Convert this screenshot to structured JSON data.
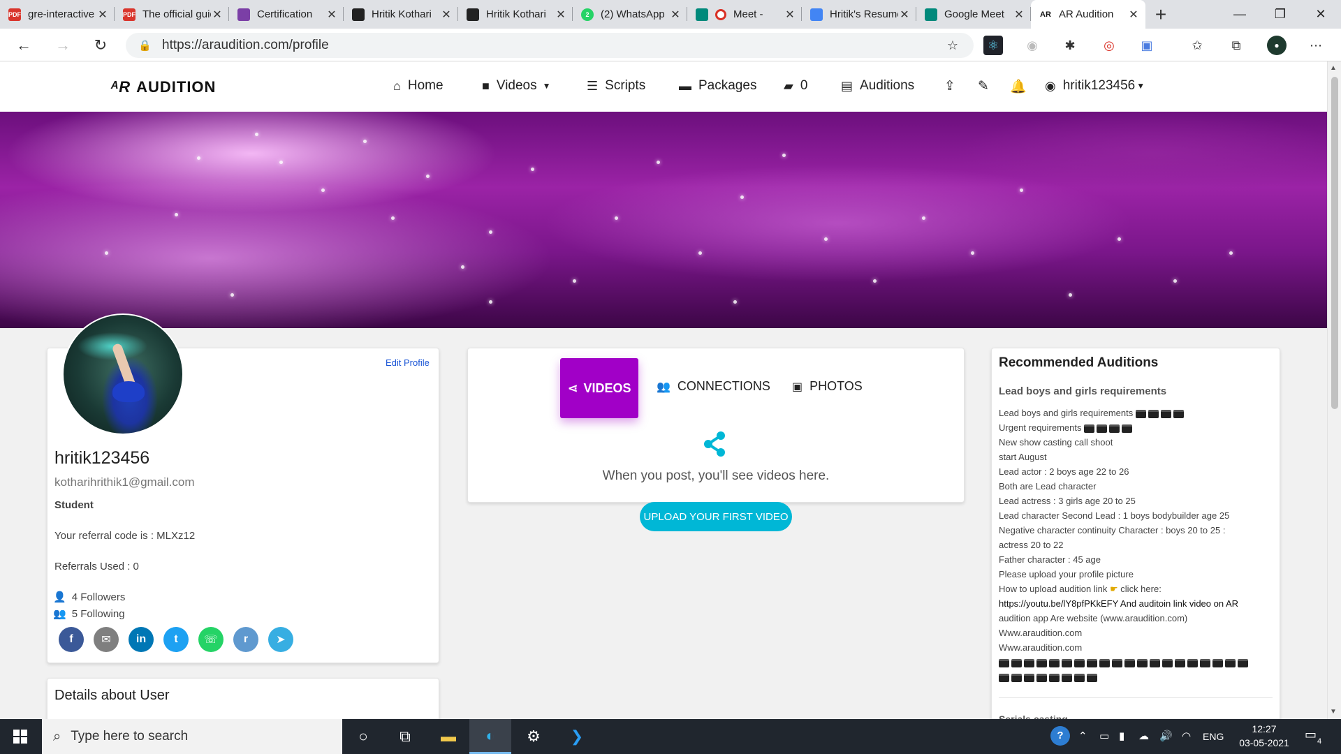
{
  "browser": {
    "tabs": [
      {
        "label": "gre-interactive",
        "fav_color": "#d9352c",
        "fav_text": "PDF"
      },
      {
        "label": "The official guide",
        "fav_color": "#d9352c",
        "fav_text": "PDF"
      },
      {
        "label": "Certification",
        "fav_color": "#7b3fa6",
        "fav_text": ""
      },
      {
        "label": "Hritik Kothari",
        "fav_color": "#222222",
        "fav_text": ""
      },
      {
        "label": "Hritik Kothari",
        "fav_color": "#222222",
        "fav_text": ""
      },
      {
        "label": "(2) WhatsApp",
        "fav_color": "#25d366",
        "fav_text": "2"
      },
      {
        "label": "Meet -",
        "fav_color": "#00897b",
        "fav_text": ""
      },
      {
        "label": "Hritik's Resume",
        "fav_color": "#4285f4",
        "fav_text": ""
      },
      {
        "label": "Google Meet",
        "fav_color": "#00897b",
        "fav_text": ""
      },
      {
        "label": "AR Audition",
        "fav_color": "#111111",
        "fav_text": "AR",
        "active": true
      }
    ],
    "url": "https://araudition.com/profile"
  },
  "site": {
    "logo": "AUDITION",
    "nav": {
      "home": "Home",
      "videos": "Videos",
      "scripts": "Scripts",
      "packages": "Packages",
      "wallet_count": "0",
      "auditions": "Auditions",
      "username": "hritik123456"
    }
  },
  "profile": {
    "edit_label": "Edit Profile",
    "username": "hritik123456",
    "email": "kotharihrithik1@gmail.com",
    "role": "Student",
    "referral_code_text": "Your referral code is : MLXz12",
    "referrals_used_text": "Referrals Used : 0",
    "followers_text": "4 Followers",
    "following_text": "5 Following",
    "details_title": "Details about User"
  },
  "content": {
    "tab_videos": "VIDEOS",
    "tab_connections": "CONNECTIONS",
    "tab_photos": "PHOTOS",
    "empty_text": "When you post, you'll see videos here.",
    "upload_button": "UPLOAD YOUR FIRST VIDEO"
  },
  "recommended": {
    "title": "Recommended Auditions",
    "subtitle": "Lead boys and girls requirements",
    "lines": [
      "Lead boys and girls requirements",
      "Urgent requirements",
      "New show casting call shoot",
      "start August",
      "Lead actor : 2 boys age 22 to 26",
      "Both are Lead character",
      "Lead actress : 3 girls age 20 to 25",
      "Lead character Second Lead : 1 boys bodybuilder age 25",
      "Negative character continuity Character : boys 20 to 25 :",
      "actress 20 to 22",
      "Father character : 45 age",
      "Please upload your profile picture",
      "How to upload audition link",
      "https://youtu.be/lY8pfPKkEFY And auditoin link video on AR",
      "audition app Are website (www.araudition.com)",
      "Www.araudition.com",
      "Www.araudition.com"
    ],
    "click_here": "click here:",
    "next_title": "Serials casting"
  },
  "taskbar": {
    "search_placeholder": "Type here to search",
    "lang": "ENG",
    "time": "12:27",
    "date": "03-05-2021",
    "notif_count": "4"
  },
  "colors": {
    "accent": "#a100c7",
    "cyan": "#00b7d6"
  }
}
